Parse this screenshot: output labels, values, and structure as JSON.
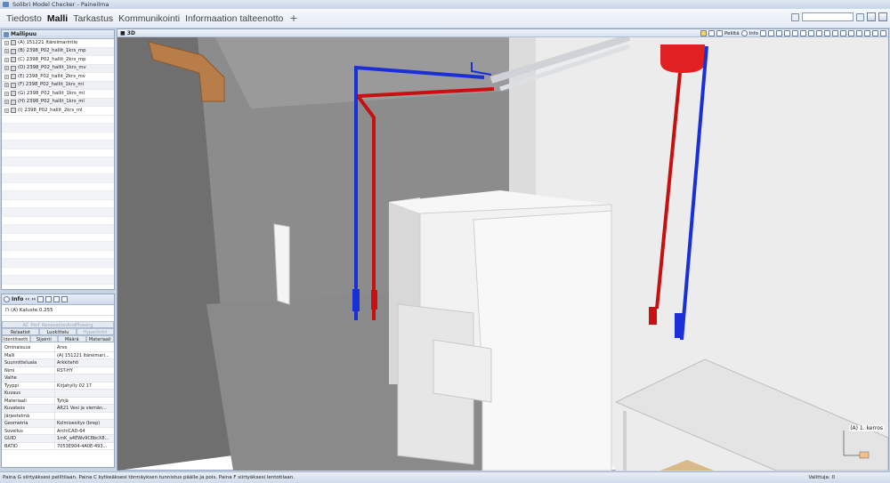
{
  "window": {
    "title": "Solibri Model Checker - Paineilma"
  },
  "menu": {
    "tabs": [
      "Tiedosto",
      "Malli",
      "Tarkastus",
      "Kommunikointi",
      "Informaation talteenotto"
    ],
    "active": "Malli",
    "add_label": "+"
  },
  "model_tree": {
    "title": "Mallipuu",
    "items": [
      "(A) 151221 Itäreimarintie",
      "(B) 2398_P02_hallit_1krs_mp",
      "(C) 2398_P02_hallit_2krs_mp",
      "(D) 2398_P02_hallit_1krs_mv",
      "(E) 2398_P02_hallit_2krs_mv",
      "(F) 2398_P02_hallit_1krs_ml",
      "(G) 2398_P02_hallit_1krs_ml",
      "(H) 2398_P02_hallit_1krs_ml",
      "(I) 2398_P02_hallit_2krs_ml"
    ]
  },
  "info": {
    "title": "Info",
    "selected": "(A) Kaluste.0.255",
    "group_tab": "AC_Perf_RenovationAndPhasing",
    "tabs_row1": [
      "Relaatiot",
      "Luokittelu",
      "Hyperlinkit"
    ],
    "tabs_row2": [
      "Identiteetti",
      "Sijainti",
      "Määrä",
      "Materiaali"
    ],
    "col_property": "Ominaisuus",
    "col_value": "Arvo",
    "properties": [
      {
        "k": "Malli",
        "v": "(A) 151221 Itäreimari..."
      },
      {
        "k": "Suunnittelu­ala",
        "v": "Arkkitehti"
      },
      {
        "k": "Nimi",
        "v": "RST-HY"
      },
      {
        "k": "Vaihe",
        "v": ""
      },
      {
        "k": "Tyyppi",
        "v": "Kirjahylly 02 17"
      },
      {
        "k": "Kuvaus",
        "v": ""
      },
      {
        "k": "Materiaali",
        "v": "Tyhjä"
      },
      {
        "k": "Kuvateos",
        "v": "AR21 Vesi ja viemän..."
      },
      {
        "k": "Järjestelmä",
        "v": ""
      },
      {
        "k": "Geometria",
        "v": "Kolmioesitys (brep)"
      },
      {
        "k": "Sovellus",
        "v": "ArchiCAD-64"
      },
      {
        "k": "GUID",
        "v": "1mK_a4EWv9C8bcX8..."
      },
      {
        "k": "BATID",
        "v": "7053E904-4A0E-493..."
      }
    ]
  },
  "view3d": {
    "label": "3D",
    "toolbar": {
      "game_label": "Peliltä",
      "info_label": "Info"
    },
    "floor_label": "(A) 1. kerros"
  },
  "status": {
    "message": "Paina G siirtyäksesi peliltilaan. Paina C kytkeäksesi törmäyksen tunnistus päälle ja pois. Paina F siirtyäksesi lentotilaan.",
    "selection": "Valittuja: 0"
  },
  "colors": {
    "pipe_hot": "#c81010",
    "pipe_cold": "#1a2fd8",
    "wall_dark": "#8e8e8e",
    "wall_light": "#e9e9e9"
  }
}
